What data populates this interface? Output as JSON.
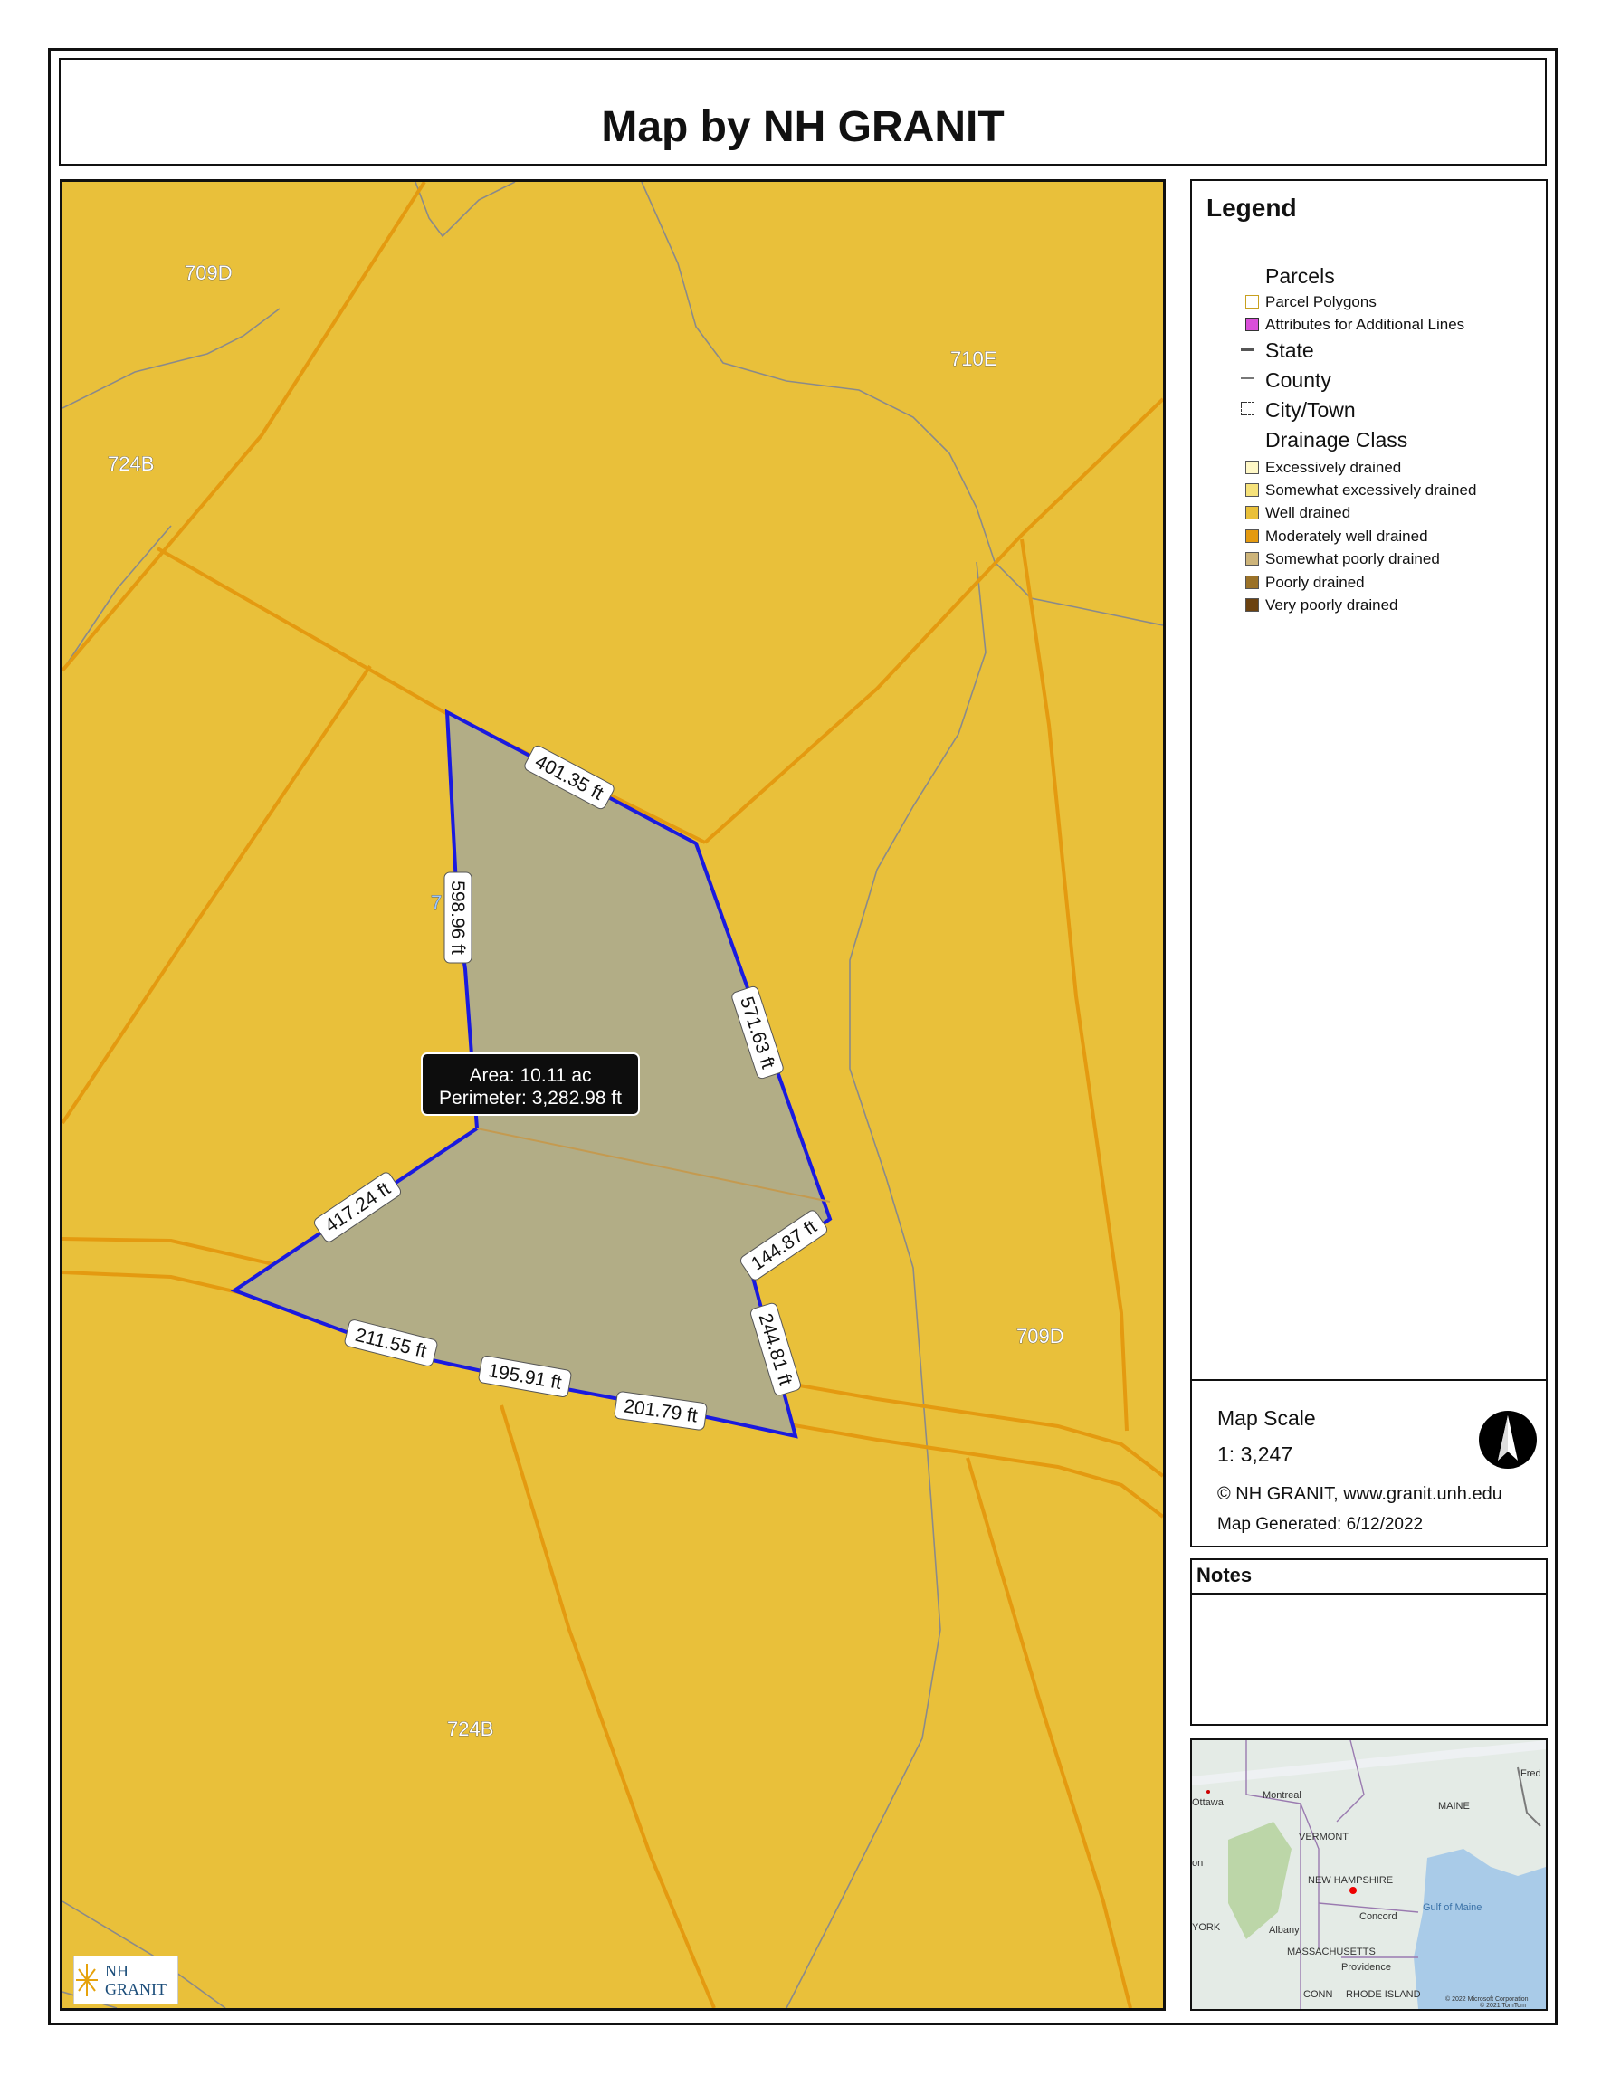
{
  "title": "Map by NH GRANIT",
  "map": {
    "soil_labels": [
      "709D",
      "710E",
      "724B",
      "709D",
      "724B"
    ],
    "hidden_label": "7 B",
    "segments": [
      "401.35 ft",
      "598.96 ft",
      "571.63 ft",
      "417.24 ft",
      "144.87 ft",
      "244.81 ft",
      "211.55 ft",
      "195.91 ft",
      "201.79 ft"
    ],
    "measure": {
      "area": "Area: 10.11 ac",
      "perimeter": "Perimeter: 3,282.98 ft"
    },
    "logo": {
      "line1": "NH",
      "line2": "GRANIT"
    },
    "colors": {
      "well_drained": "#e9c03a",
      "boundary": "#1a1adf",
      "parcel_line": "#e49a10",
      "selection": "#b2ad86"
    }
  },
  "legend": {
    "title": "Legend",
    "parcels_heading": "Parcels",
    "parcel_items": [
      {
        "label": "Parcel Polygons",
        "color": "#ffffff",
        "border": "#c8a020"
      },
      {
        "label": "Attributes for Additional Lines",
        "color": "#d94fd9",
        "border": "#333333"
      }
    ],
    "state": "State",
    "county": "County",
    "city_town": "City/Town",
    "drainage_heading": "Drainage Class",
    "drainage_items": [
      {
        "label": "Excessively drained",
        "color": "#fff8c6"
      },
      {
        "label": "Somewhat excessively drained",
        "color": "#f6e27a"
      },
      {
        "label": "Well drained",
        "color": "#e9c03a"
      },
      {
        "label": "Moderately well drained",
        "color": "#e49a10"
      },
      {
        "label": "Somewhat poorly drained",
        "color": "#cdb47a"
      },
      {
        "label": "Poorly drained",
        "color": "#9b7228"
      },
      {
        "label": "Very poorly drained",
        "color": "#6b4210"
      }
    ]
  },
  "scale": {
    "label": "Map Scale",
    "value": "1: 3,247",
    "copyright": "© NH GRANIT, www.granit.unh.edu",
    "generated": "Map Generated:  6/12/2022"
  },
  "notes": {
    "heading": "Notes"
  },
  "inset": {
    "places": [
      "Ottawa",
      "Montreal",
      "VERMONT",
      "MAINE",
      "NEW HAMPSHIRE",
      "Concord",
      "Albany",
      "MASSACHUSETTS",
      "Providence",
      "Gulf of Maine",
      "YORK",
      "CONN",
      "RHODE ISLAND",
      "Fred",
      "on"
    ],
    "attribution1": "© 2022 Microsoft Corporation",
    "attribution2": "© 2021 TomTom"
  }
}
